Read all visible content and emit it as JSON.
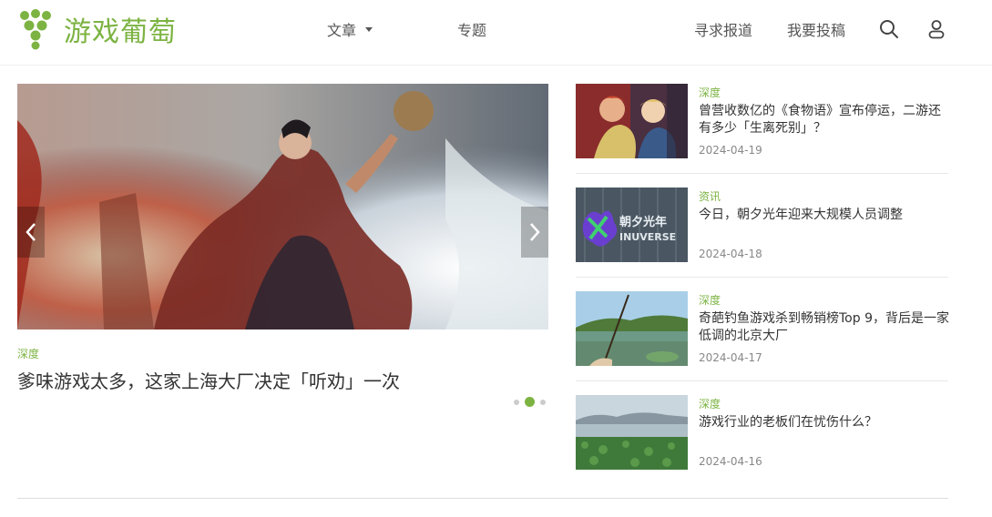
{
  "brand": {
    "name": "游戏葡萄",
    "color": "#7cb342"
  },
  "nav": {
    "articles": "文章",
    "topics": "专题",
    "report": "寻求报道",
    "submit": "我要投稿"
  },
  "featured": {
    "tag": "深度",
    "title": "爹味游戏太多，这家上海大厂决定「听劝」一次",
    "slide_count": 3,
    "active_slide": 2
  },
  "side_list": [
    {
      "tag": "深度",
      "title": "曾营收数亿的《食物语》宣布停运，二游还有多少「生离死别」？",
      "date": "2024-04-19",
      "thumb_icon": "anime-characters-thumbnail"
    },
    {
      "tag": "资讯",
      "title": "今日，朝夕光年迎来大规模人员调整",
      "date": "2024-04-18",
      "thumb_icon": "inuverse-logo-thumbnail",
      "thumb_text_1": "朝夕光年",
      "thumb_text_2": "INUVERSE"
    },
    {
      "tag": "深度",
      "title": "奇葩钓鱼游戏杀到畅销榜Top 9，背后是一家低调的北京大厂",
      "date": "2024-04-17",
      "thumb_icon": "fishing-lake-thumbnail"
    },
    {
      "tag": "深度",
      "title": "游戏行业的老板们在忧伤什么？",
      "date": "2024-04-16",
      "thumb_icon": "lake-landscape-thumbnail"
    }
  ]
}
